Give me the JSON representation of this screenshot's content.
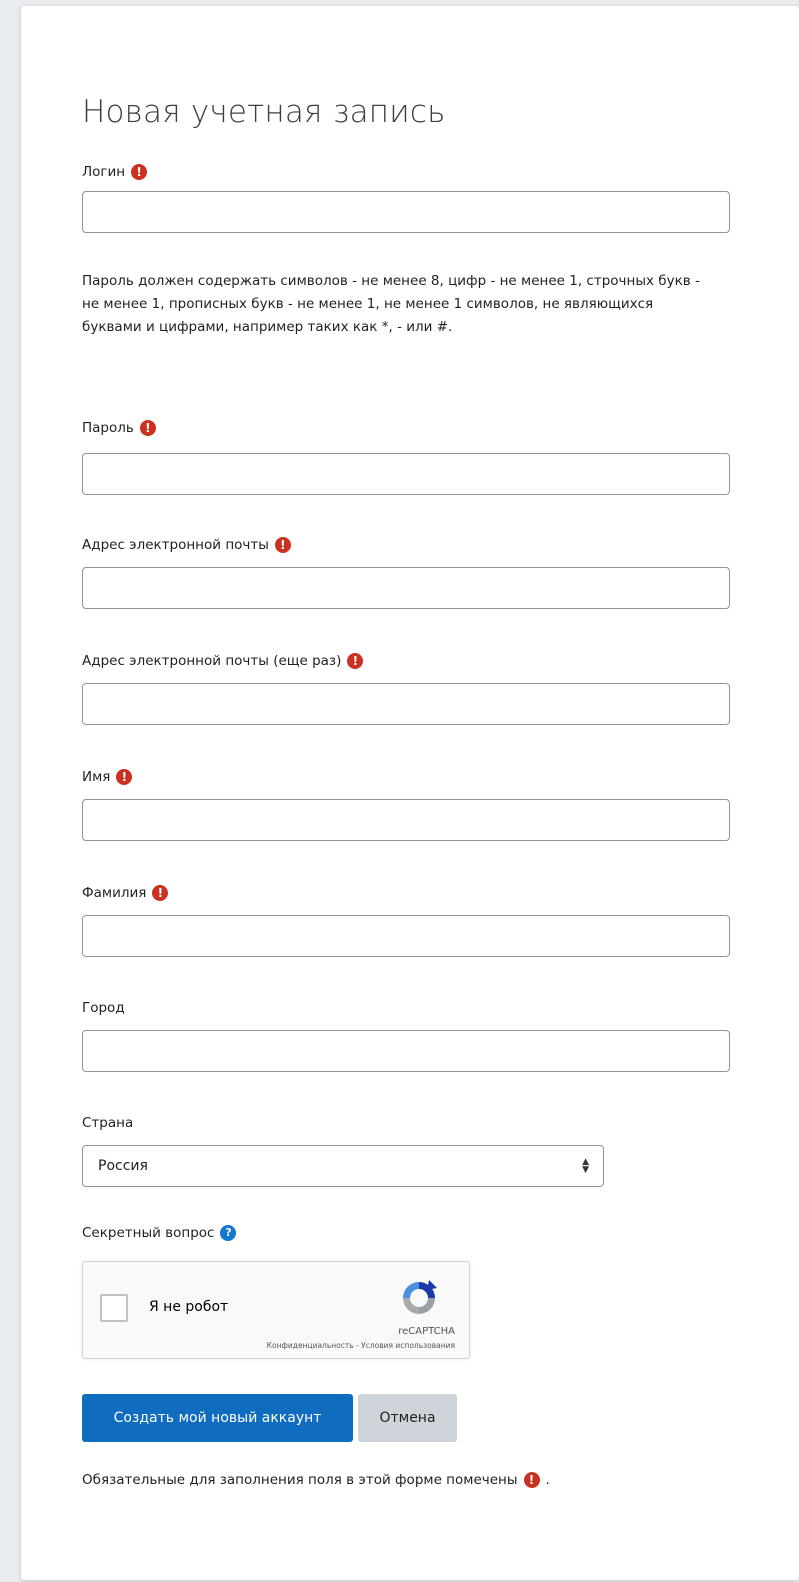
{
  "form": {
    "title": "Новая учетная запись",
    "required_mark": "!",
    "help_mark": "?",
    "login_label": "Логин",
    "login_value": "",
    "password_hint": "Пароль должен содержать символов - не менее 8, цифр - не менее 1, строчных букв - не менее 1, прописных букв - не менее 1, не менее 1 символов, не являющихся буквами и цифрами, например таких как *, - или #.",
    "password_label": "Пароль",
    "password_value": "",
    "email_label": "Адрес электронной почты",
    "email_value": "",
    "email2_label": "Адрес электронной почты (еще раз)",
    "email2_value": "",
    "firstname_label": "Имя",
    "firstname_value": "",
    "lastname_label": "Фамилия",
    "lastname_value": "",
    "city_label": "Город",
    "city_value": "",
    "country_label": "Страна",
    "country_selected": "Россия",
    "secret_label": "Секретный вопрос"
  },
  "captcha": {
    "checkbox_label": "Я не робот",
    "brand": "reCAPTCHA",
    "links": "Конфиденциальность - Условия использования"
  },
  "actions": {
    "submit_label": "Создать мой новый аккаунт",
    "cancel_label": "Отмена"
  },
  "footer": {
    "required_note": "Обязательные для заполнения поля в этой форме помечены",
    "trailing": "."
  },
  "colors": {
    "primary": "#0f6cbf",
    "required": "#ca3120",
    "help": "#1177d1",
    "secondary_button": "#ced4da"
  },
  "icons": {
    "required": "exclamation-circle-icon",
    "help": "question-circle-icon",
    "select": "sort-caret-icon",
    "captcha": "recaptcha-logo-icon"
  }
}
